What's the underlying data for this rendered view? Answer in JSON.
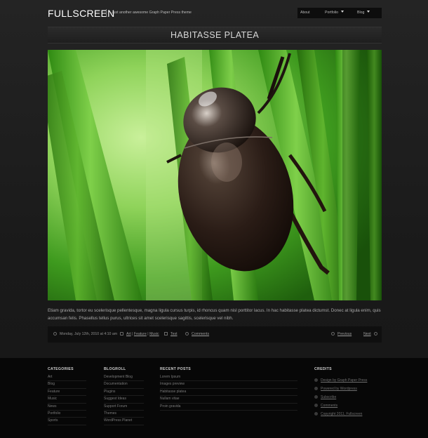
{
  "site": {
    "title": "FULLSCREEN",
    "tagline": "Just another awesome Graph Paper Press theme"
  },
  "nav": {
    "items": [
      {
        "label": "About",
        "has_dropdown": false
      },
      {
        "label": "Portfolio",
        "has_dropdown": true
      },
      {
        "label": "Blog",
        "has_dropdown": true
      }
    ]
  },
  "post": {
    "title": "HABITASSE PLATEA",
    "image_icon": "beetle-on-grass-photo",
    "excerpt": "Etiam gravida, tortor eu scelerisque pellentesque, magna ligula cursus turpis, id rhoncus quam nisl porttitor lacus. In hac habitasse platea dictumst. Donec at ligula enim, quis accumsan felis. Phasellus tellus purus, ultrices sit amet scelerisque sagittis, scelerisque vel nibh."
  },
  "meta": {
    "date": "Monday, July 12th, 2010 at 4:10 am",
    "categories": [
      "Art",
      "Feature",
      "Music"
    ],
    "separator": "|",
    "tag": "Test",
    "comments": "Comments",
    "previous": "Previous",
    "next": "Next"
  },
  "footer": {
    "categories": {
      "heading": "CATEGORIES",
      "items": [
        "Art",
        "Blog",
        "Feature",
        "Music",
        "News",
        "Portfolio",
        "Sports"
      ]
    },
    "blogroll": {
      "heading": "BLOGROLL",
      "items": [
        "Development Blog",
        "Documentation",
        "Plugins",
        "Suggest Ideas",
        "Support Forum",
        "Themes",
        "WordPress Planet"
      ]
    },
    "recent_posts": {
      "heading": "RECENT POSTS",
      "items": [
        "Lorem Ipsum",
        "Images preview",
        "Habitasse platea",
        "Nullam vitae",
        "Proin gravida"
      ]
    },
    "credits": {
      "heading": "CREDITS",
      "items": [
        "Design by Graph Paper Press",
        "Powered by Wordpress",
        "Subscribe",
        "Comments",
        "Copyright 2011, Fullscreen"
      ]
    }
  }
}
